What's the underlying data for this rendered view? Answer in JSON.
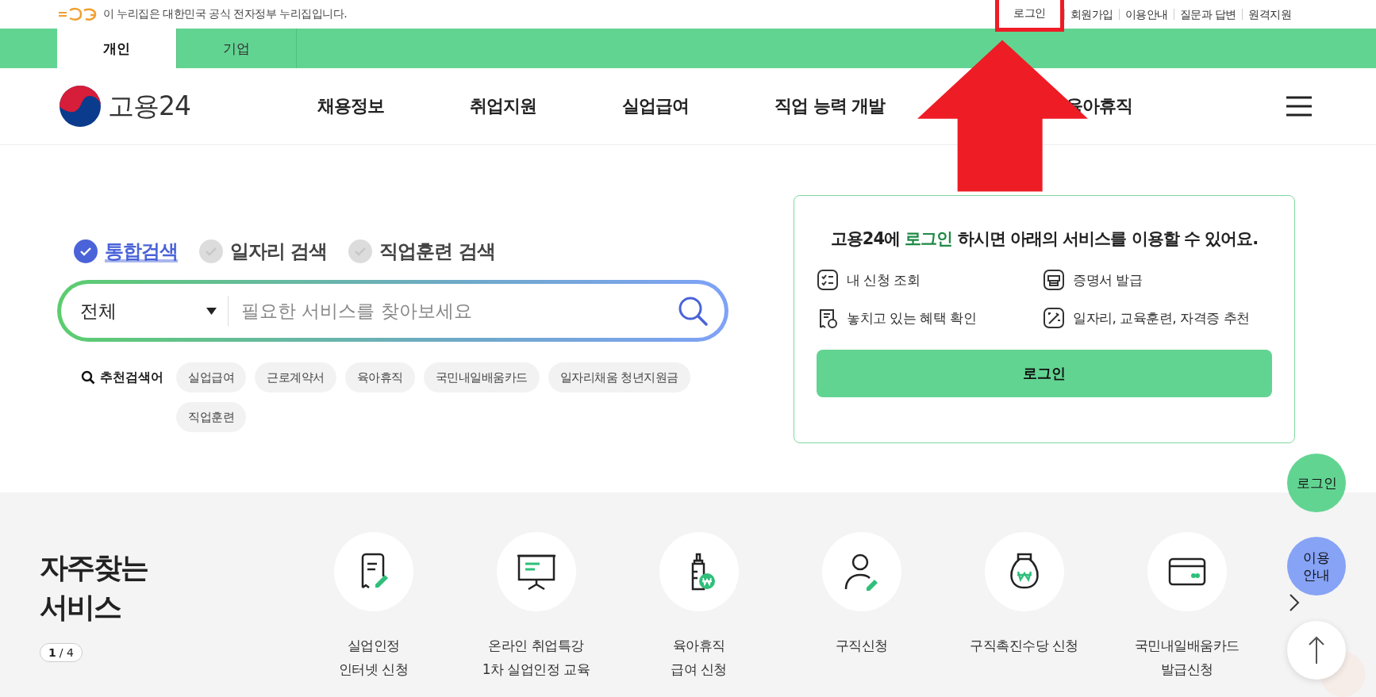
{
  "gov_notice": {
    "text": "이 누리집은 대한민국 공식 전자정부 누리집입니다."
  },
  "utility_links": [
    {
      "label": "로그인",
      "marked": true
    },
    {
      "label": "회원가입",
      "marked": false
    },
    {
      "label": "이용안내",
      "marked": false
    },
    {
      "label": "질문과 답변",
      "marked": false
    },
    {
      "label": "원격지원",
      "marked": false
    }
  ],
  "audience_tabs": [
    {
      "label": "개인",
      "selected": true
    },
    {
      "label": "기업",
      "selected": false
    }
  ],
  "logo": {
    "text": "고용24"
  },
  "main_menu": [
    {
      "label": "채용정보"
    },
    {
      "label": "취업지원"
    },
    {
      "label": "실업급여"
    },
    {
      "label": "직업 능력 개발"
    },
    {
      "label": "육아휴직"
    }
  ],
  "search": {
    "types": [
      {
        "label": "통합검색",
        "selected": true
      },
      {
        "label": "일자리 검색",
        "selected": false
      },
      {
        "label": "직업훈련 검색",
        "selected": false
      }
    ],
    "category": "전체",
    "placeholder": "필요한 서비스를 찾아보세요",
    "recommended_label": "추천검색어",
    "recommended": [
      "실업급여",
      "근로계약서",
      "육아휴직",
      "국민내일배움카드",
      "일자리채움 청년지원금",
      "직업훈련"
    ]
  },
  "login_card": {
    "title": "고용24에 **로그인** 하시면 아래의 서비스를 이용할 수 있어요.",
    "services": [
      {
        "label": "내 신청 조회",
        "kind": "checklist"
      },
      {
        "label": "증명서 발급",
        "kind": "printer"
      },
      {
        "label": "놓치고 있는 혜택 확인",
        "kind": "receipt"
      },
      {
        "label": "일자리, 교육훈련, 자격증 추천",
        "kind": "wand"
      }
    ],
    "button": "로그인"
  },
  "frequent_services": {
    "title": "자주찾는 서비스",
    "page_indicator": "**1** / 4",
    "items": [
      {
        "label": "실업인정\n인터넷 신청",
        "kind": "document"
      },
      {
        "label": "온라인 취업특강\n1차 실업인정 교육",
        "kind": "presentation"
      },
      {
        "label": "육아휴직\n급여 신청",
        "kind": "bottle"
      },
      {
        "label": "구직신청",
        "kind": "person"
      },
      {
        "label": "구직촉진수당 신청",
        "kind": "bag"
      },
      {
        "label": "국민내일배움카드\n발급신청",
        "kind": "card"
      }
    ]
  },
  "floating": {
    "login": "로그인",
    "guide": "이용\n안내"
  }
}
